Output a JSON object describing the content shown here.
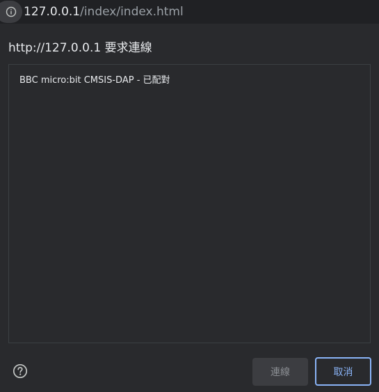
{
  "url_bar": {
    "host": "127.0.0.1",
    "path": "/index/index.html"
  },
  "dialog": {
    "title": "http://127.0.0.1 要求連線",
    "devices": [
      {
        "label": "BBC micro:bit CMSIS-DAP - 已配對"
      }
    ],
    "connect_label": "連線",
    "cancel_label": "取消"
  },
  "icons": {
    "info": "info-icon",
    "help": "help-icon"
  },
  "colors": {
    "background": "#292a2d",
    "accent": "#8ab4f8",
    "disabled_button": "#3c3d41"
  }
}
